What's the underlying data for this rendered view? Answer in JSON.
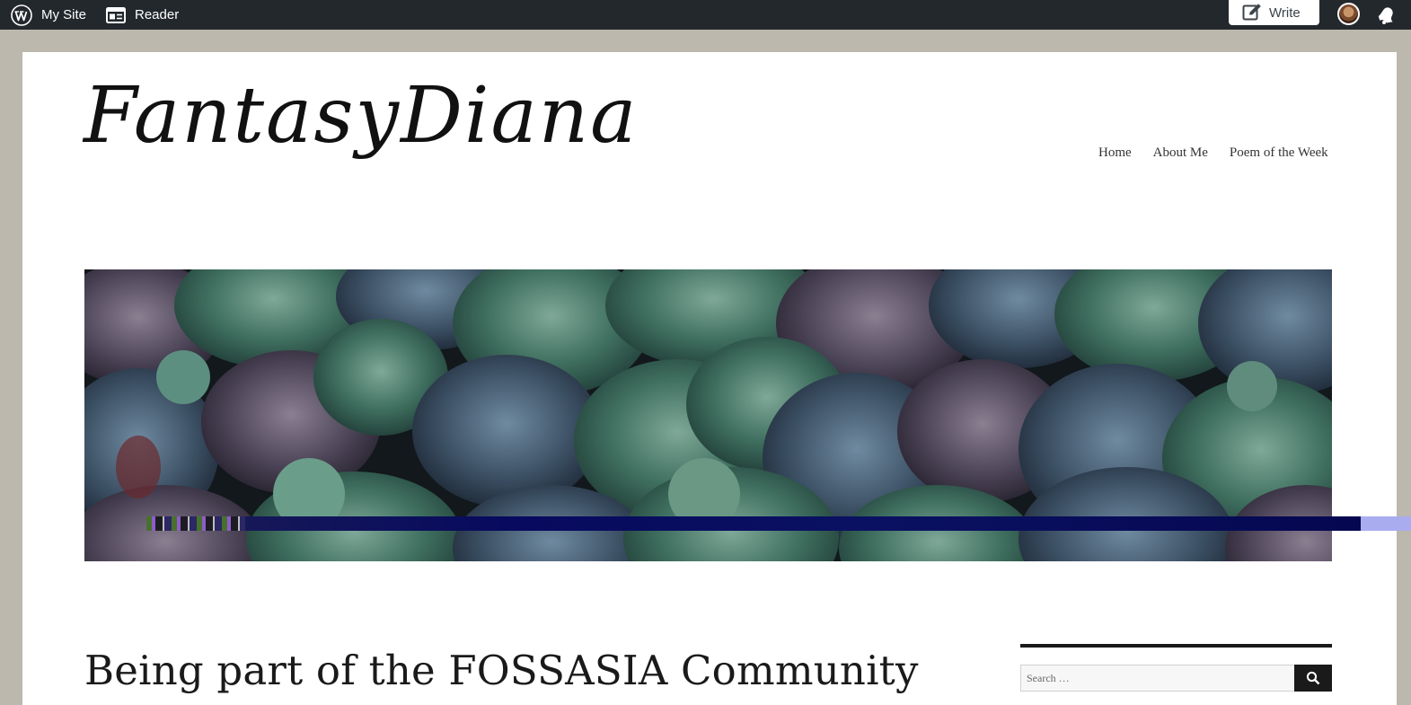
{
  "admin_bar": {
    "my_site_label": "My Site",
    "reader_label": "Reader",
    "write_label": "Write",
    "icons": [
      "wordpress-logo-icon",
      "reader-icon",
      "write-icon",
      "avatar",
      "notifications-icon"
    ]
  },
  "site": {
    "title": "FantasyDiana"
  },
  "nav": {
    "items": [
      {
        "label": "Home"
      },
      {
        "label": "About Me"
      },
      {
        "label": "Poem of the Week"
      }
    ]
  },
  "post": {
    "title": "Being part of the FOSSASIA Community"
  },
  "sidebar": {
    "search": {
      "placeholder": "Search …",
      "icon": "search-icon"
    }
  },
  "colors": {
    "admin_bar_bg": "#23282d",
    "page_bg": "#bcb8ad",
    "sheet_bg": "#ffffff",
    "text": "#1a1a1a"
  }
}
